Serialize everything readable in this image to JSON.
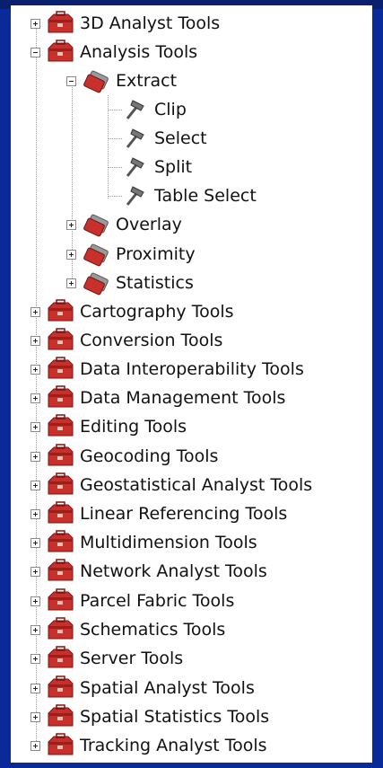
{
  "tree": {
    "toolboxes": [
      {
        "label": "3D Analyst Tools",
        "expanded": false
      },
      {
        "label": "Analysis Tools",
        "expanded": true,
        "toolsets": [
          {
            "label": "Extract",
            "expanded": true,
            "tools": [
              {
                "label": "Clip"
              },
              {
                "label": "Select"
              },
              {
                "label": "Split"
              },
              {
                "label": "Table Select"
              }
            ]
          },
          {
            "label": "Overlay",
            "expanded": false
          },
          {
            "label": "Proximity",
            "expanded": false
          },
          {
            "label": "Statistics",
            "expanded": false
          }
        ]
      },
      {
        "label": "Cartography Tools",
        "expanded": false
      },
      {
        "label": "Conversion Tools",
        "expanded": false
      },
      {
        "label": "Data Interoperability Tools",
        "expanded": false
      },
      {
        "label": "Data Management Tools",
        "expanded": false
      },
      {
        "label": "Editing Tools",
        "expanded": false
      },
      {
        "label": "Geocoding Tools",
        "expanded": false
      },
      {
        "label": "Geostatistical Analyst Tools",
        "expanded": false
      },
      {
        "label": "Linear Referencing Tools",
        "expanded": false
      },
      {
        "label": "Multidimension Tools",
        "expanded": false
      },
      {
        "label": "Network Analyst Tools",
        "expanded": false
      },
      {
        "label": "Parcel Fabric Tools",
        "expanded": false
      },
      {
        "label": "Schematics Tools",
        "expanded": false
      },
      {
        "label": "Server Tools",
        "expanded": false
      },
      {
        "label": "Spatial Analyst Tools",
        "expanded": false
      },
      {
        "label": "Spatial Statistics Tools",
        "expanded": false
      },
      {
        "label": "Tracking Analyst Tools",
        "expanded": false
      }
    ]
  },
  "icons": {
    "toolbox": "toolbox-icon",
    "toolset": "toolset-icon",
    "tool": "hammer-icon",
    "expand": "plus-icon",
    "collapse": "minus-icon"
  },
  "colors": {
    "frame": "#0b2a9a",
    "toolbox_red": "#c8302c"
  }
}
